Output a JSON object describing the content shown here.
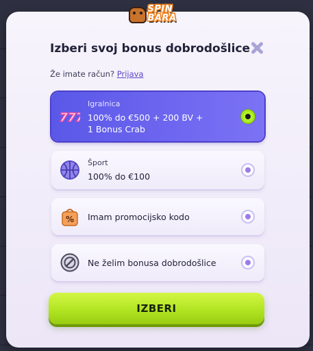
{
  "logo": {
    "text": "SPIN BARA",
    "icon": "capybara-logo-icon"
  },
  "modal": {
    "title": "Izberi svoj bonus dobrodošlice",
    "close_icon": "close-icon",
    "login_prompt": "Že imate račun?",
    "login_link": "Prijava"
  },
  "options": [
    {
      "category": "Igralnica",
      "text_line1": "100% do €500 + 200 BV +",
      "text_line2": "1 Bonus Crab",
      "icon": "slot-777-icon",
      "selected": true
    },
    {
      "category": "Šport",
      "text_line1": "100% do €100",
      "icon": "basketball-icon",
      "selected": false
    },
    {
      "category": "",
      "text_line1": "Imam promocijsko kodo",
      "icon": "promo-bag-icon",
      "selected": false
    },
    {
      "category": "",
      "text_line1": "Ne želim bonusa dobrodošlice",
      "icon": "no-bonus-icon",
      "selected": false
    }
  ],
  "cta": {
    "label": "IZBERI"
  },
  "colors": {
    "accent": "#6a62ee",
    "cta": "#b6ea25",
    "modal_bg": "#f4f0fb"
  }
}
